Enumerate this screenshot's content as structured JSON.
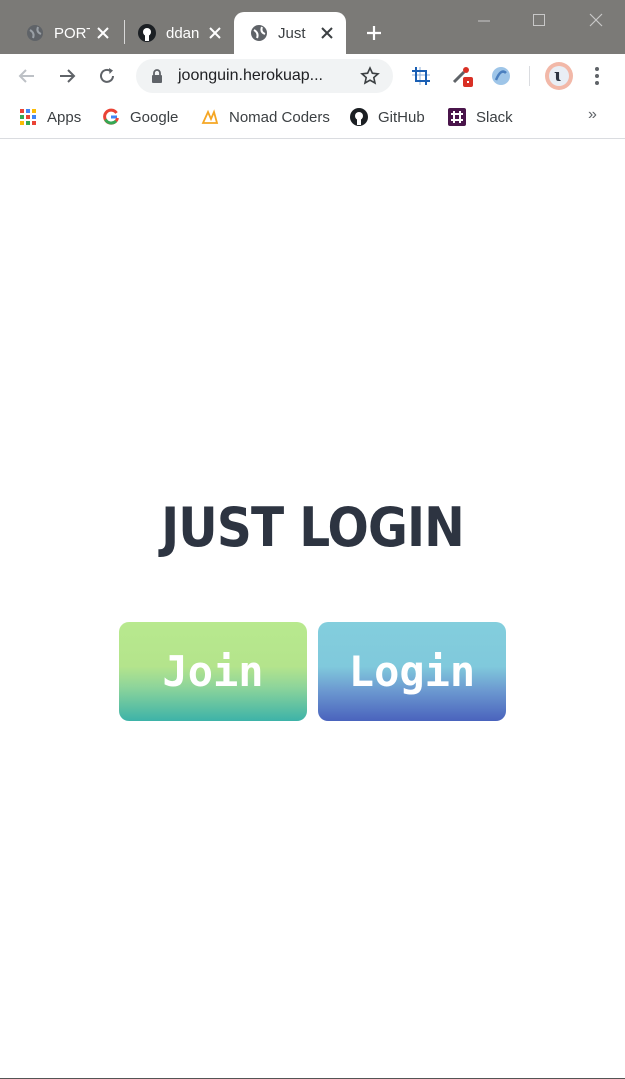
{
  "browser": {
    "tabs": [
      {
        "title": "PORT",
        "icon": "globe-icon",
        "active": false
      },
      {
        "title": "ddan",
        "icon": "github-icon",
        "active": false
      },
      {
        "title": "Just",
        "icon": "globe-icon",
        "active": true
      }
    ],
    "address_bar": {
      "url": "joonguin.herokuap..."
    },
    "bookmarks": [
      {
        "label": "Apps",
        "icon": "apps-grid-icon"
      },
      {
        "label": "Google",
        "icon": "google-icon"
      },
      {
        "label": "Nomad Coders",
        "icon": "nomad-coders-icon"
      },
      {
        "label": "GitHub",
        "icon": "github-icon"
      },
      {
        "label": "Slack",
        "icon": "slack-icon"
      }
    ],
    "bookmarks_overflow": "»",
    "profile_initial": "ɩ"
  },
  "page": {
    "heading": "JUST LOGIN",
    "join_button": "Join",
    "login_button": "Login"
  },
  "colors": {
    "heading": "#2d3441",
    "join_gradient_top": "#b8e98e",
    "join_gradient_bottom": "#3db3a8",
    "login_gradient_top": "#83cedd",
    "login_gradient_bottom": "#4a63bd",
    "tabstrip": "#7b7a77"
  }
}
